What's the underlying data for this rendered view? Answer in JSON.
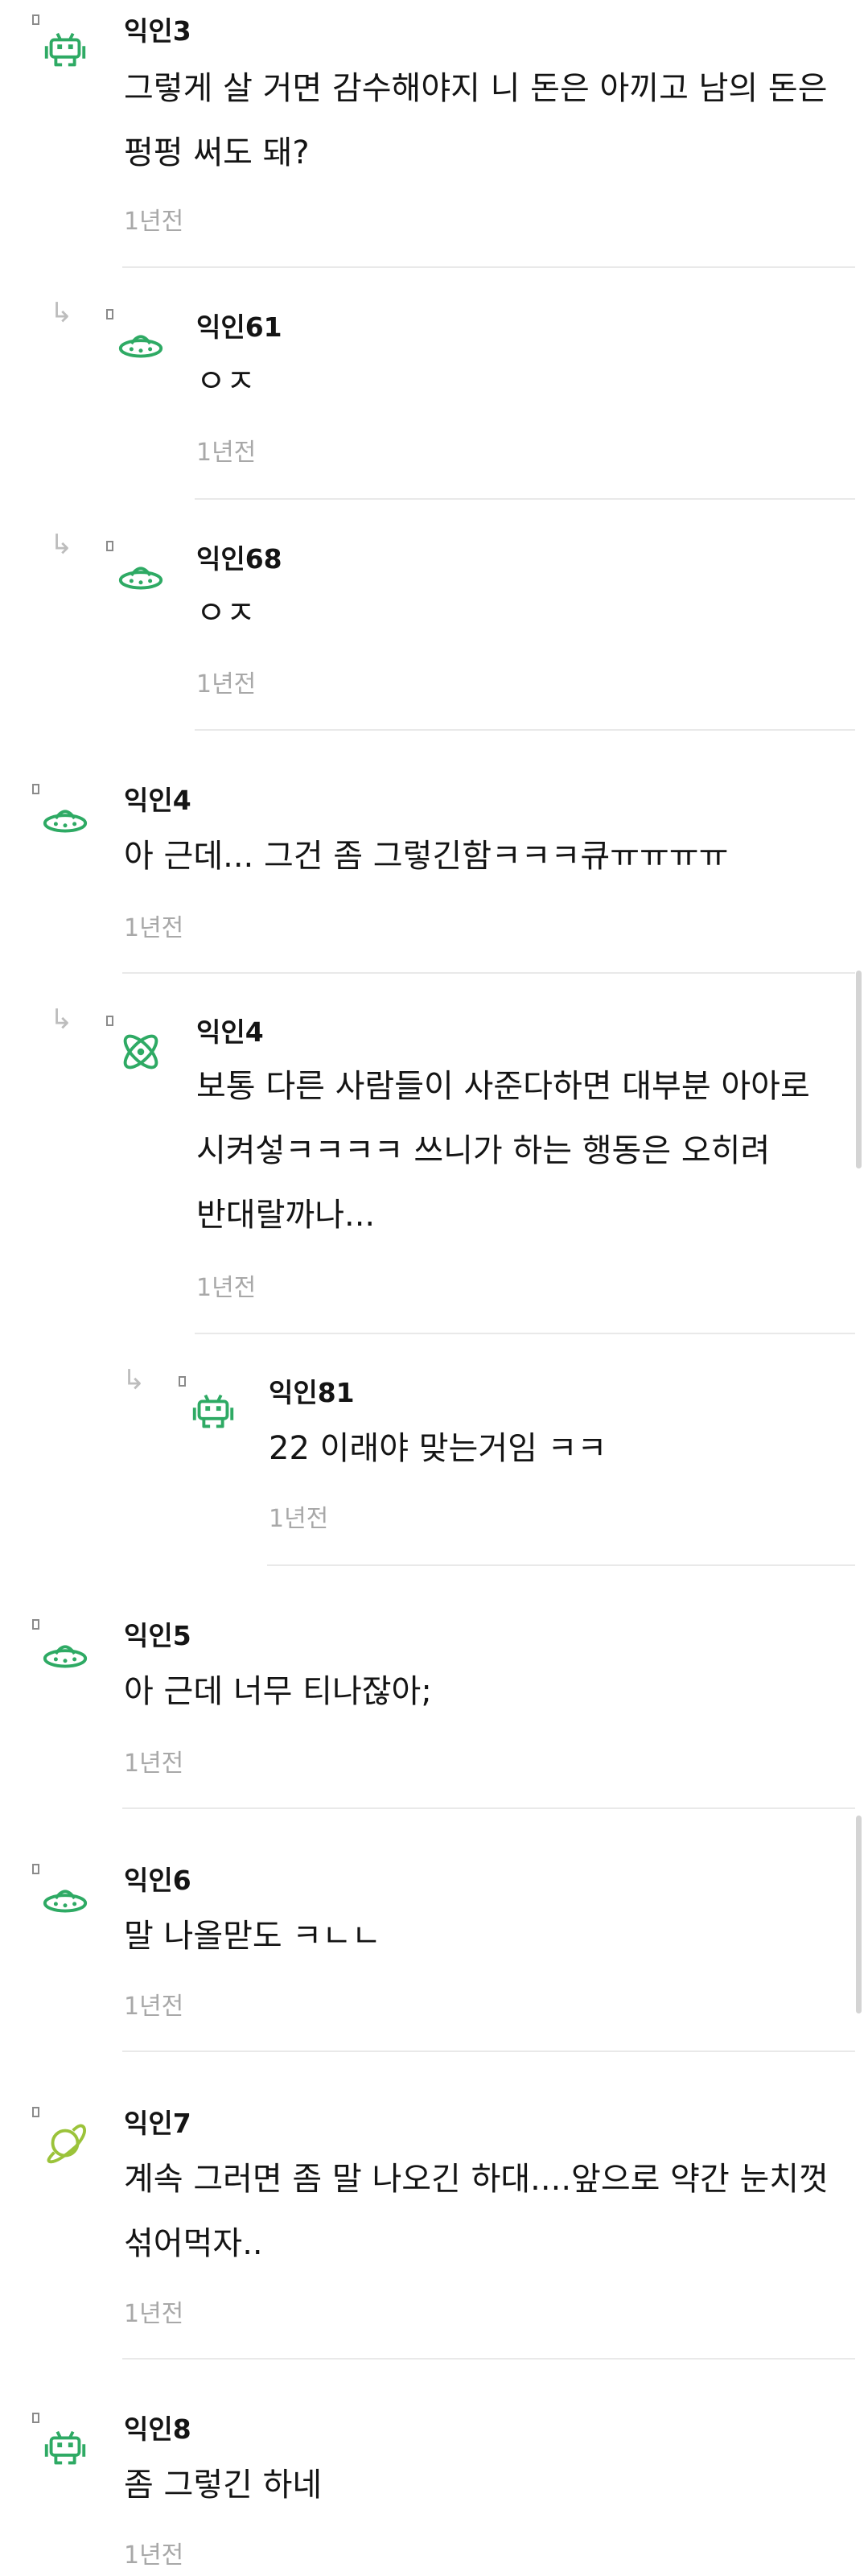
{
  "colors": {
    "icon_green": "#2eaa64",
    "icon_lime": "#9bc33a",
    "time_gray": "#a8a8a8",
    "divider": "#e9e9e9"
  },
  "comments": [
    {
      "user": "익인3",
      "text": "그렇게 살 거면 감수해야지 니 돈은 아끼고 남의 돈은 펑펑 써도 돼?",
      "time": "1년전",
      "icon": "space-invader-icon"
    },
    {
      "user": "익인61",
      "text": "ㅇㅈ",
      "time": "1년전",
      "icon": "ufo-icon"
    },
    {
      "user": "익인68",
      "text": "ㅇㅈ",
      "time": "1년전",
      "icon": "ufo-icon"
    },
    {
      "user": "익인4",
      "text": "아 근데... 그건 좀 그렇긴함ㅋㅋㅋ큐ㅠㅠㅠㅠ",
      "time": "1년전",
      "icon": "ufo-icon"
    },
    {
      "user": "익인4",
      "text": "보통 다른 사람들이 사준다하면 대부분 아아로 시켜섷ㅋㅋㅋㅋ 쓰니가 하는 행동은 오히려 반대랄까나...",
      "time": "1년전",
      "icon": "atom-icon"
    },
    {
      "user": "익인81",
      "text": "22 이래야 맞는거임 ㅋㅋ",
      "time": "1년전",
      "icon": "space-invader-icon"
    },
    {
      "user": "익인5",
      "text": "아 근데 너무 티나잖아;",
      "time": "1년전",
      "icon": "ufo-icon"
    },
    {
      "user": "익인6",
      "text": "말 나올맏도 ㅋㄴㄴ",
      "time": "1년전",
      "icon": "ufo-icon"
    },
    {
      "user": "익인7",
      "text": "계속 그러면 좀 말 나오긴 하대....앞으로 약간 눈치껏 섞어먹자..",
      "time": "1년전",
      "icon": "planet-icon"
    },
    {
      "user": "익인8",
      "text": "좀 그렇긴 하네",
      "time": "1년전",
      "icon": "space-invader-icon"
    }
  ]
}
